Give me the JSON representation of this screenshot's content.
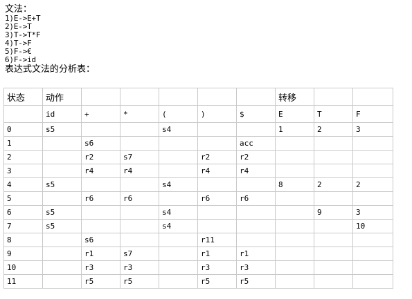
{
  "grammar": {
    "title": "文法：",
    "rules": [
      "1)E->E+T",
      "2)E->T",
      "3)T->T*F",
      "4)T->F",
      "5)F->€",
      "6)F->id"
    ]
  },
  "table": {
    "title": "表达式文法的分析表：",
    "header1": [
      "状态",
      "动作",
      "",
      "",
      "",
      "",
      "",
      "转移",
      "",
      ""
    ],
    "header2": [
      "",
      "id",
      "+",
      "*",
      "(",
      ")",
      "$",
      "E",
      "T",
      "F"
    ],
    "rows": [
      [
        "0",
        "s5",
        "",
        "",
        "s4",
        "",
        "",
        "1",
        "2",
        "3"
      ],
      [
        "1",
        "",
        "s6",
        "",
        "",
        "",
        "acc",
        "",
        "",
        ""
      ],
      [
        "2",
        "",
        "r2",
        "s7",
        "",
        "r2",
        "r2",
        "",
        "",
        ""
      ],
      [
        "3",
        "",
        "r4",
        "r4",
        "",
        "r4",
        "r4",
        "",
        "",
        ""
      ],
      [
        "4",
        "s5",
        "",
        "",
        "s4",
        "",
        "",
        "8",
        "2",
        "2"
      ],
      [
        "5",
        "",
        "r6",
        "r6",
        "",
        "r6",
        "r6",
        "",
        "",
        ""
      ],
      [
        "6",
        "s5",
        "",
        "",
        "s4",
        "",
        "",
        "",
        "9",
        "3"
      ],
      [
        "7",
        "s5",
        "",
        "",
        "s4",
        "",
        "",
        "",
        "",
        "10"
      ],
      [
        "8",
        "",
        "s6",
        "",
        "",
        "r11",
        "",
        "",
        "",
        ""
      ],
      [
        "9",
        "",
        "r1",
        "s7",
        "",
        "r1",
        "r1",
        "",
        "",
        ""
      ],
      [
        "10",
        "",
        "r3",
        "r3",
        "",
        "r3",
        "r3",
        "",
        "",
        ""
      ],
      [
        "11",
        "",
        "r5",
        "r5",
        "",
        "r5",
        "r5",
        "",
        "",
        ""
      ]
    ]
  }
}
